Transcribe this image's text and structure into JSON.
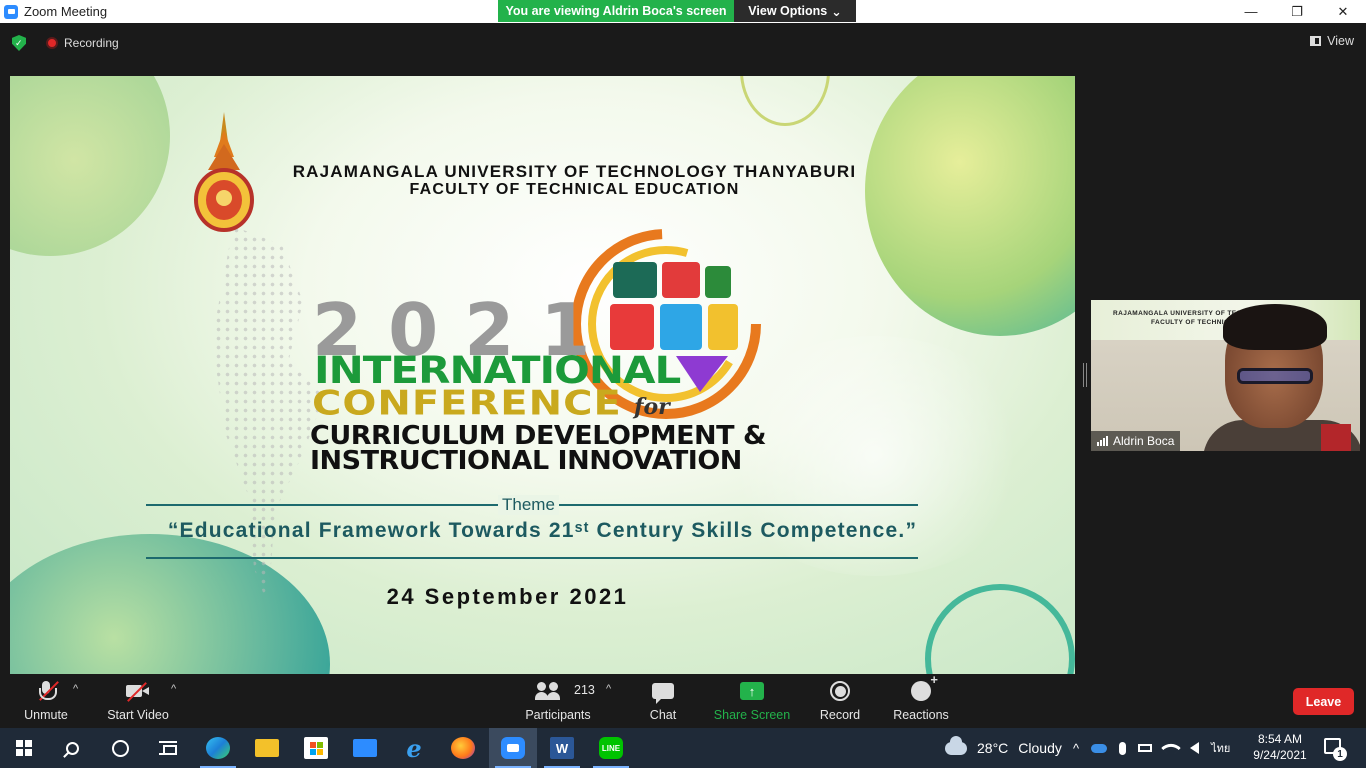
{
  "window": {
    "title": "Zoom Meeting",
    "minimize": "—",
    "restore": "❐",
    "close": "✕"
  },
  "banner": {
    "viewing": "You are viewing Aldrin Boca's screen",
    "view_options": "View Options",
    "chevron": "⌄"
  },
  "meeting": {
    "recording": "Recording",
    "view": "View"
  },
  "slide": {
    "university": "RAJAMANGALA UNIVERSITY OF TECHNOLOGY THANYABURI",
    "faculty": "FACULTY OF TECHNICAL EDUCATION",
    "year": "2021",
    "line_international": "INTERNATIONAL",
    "line_conference": "CONFERENCE",
    "line_for": "for",
    "line_curriculum": "CURRICULUM DEVELOPMENT &",
    "line_instructional": "INSTRUCTIONAL INNOVATION",
    "theme_label": "Theme",
    "theme_quote": "“Educational Framework Towards 21ˢᵗ Century Skills Competence.”",
    "date": "24 September 2021"
  },
  "speaker": {
    "name": "Aldrin Boca",
    "bg_line1": "RAJAMANGALA UNIVERSITY OF TECHNOLOGY THA",
    "bg_line2": "FACULTY OF TECHNICAL EDUCATIO"
  },
  "controls": {
    "unmute": "Unmute",
    "start_video": "Start Video",
    "participants": "Participants",
    "participant_count": "213",
    "chat": "Chat",
    "share_screen": "Share Screen",
    "share_arrow": "↑",
    "record": "Record",
    "reactions": "Reactions",
    "leave": "Leave",
    "caret": "^"
  },
  "taskbar": {
    "weather_temp": "28°C",
    "weather_desc": "Cloudy",
    "tray_chevron": "^",
    "language": "ไทย",
    "time": "8:54 AM",
    "date": "9/24/2021",
    "notification_count": "1",
    "word_letter": "W"
  },
  "colors": {
    "zoom_green": "#23b24b",
    "leave_red": "#e02828",
    "zoom_blue": "#2d8cff"
  }
}
